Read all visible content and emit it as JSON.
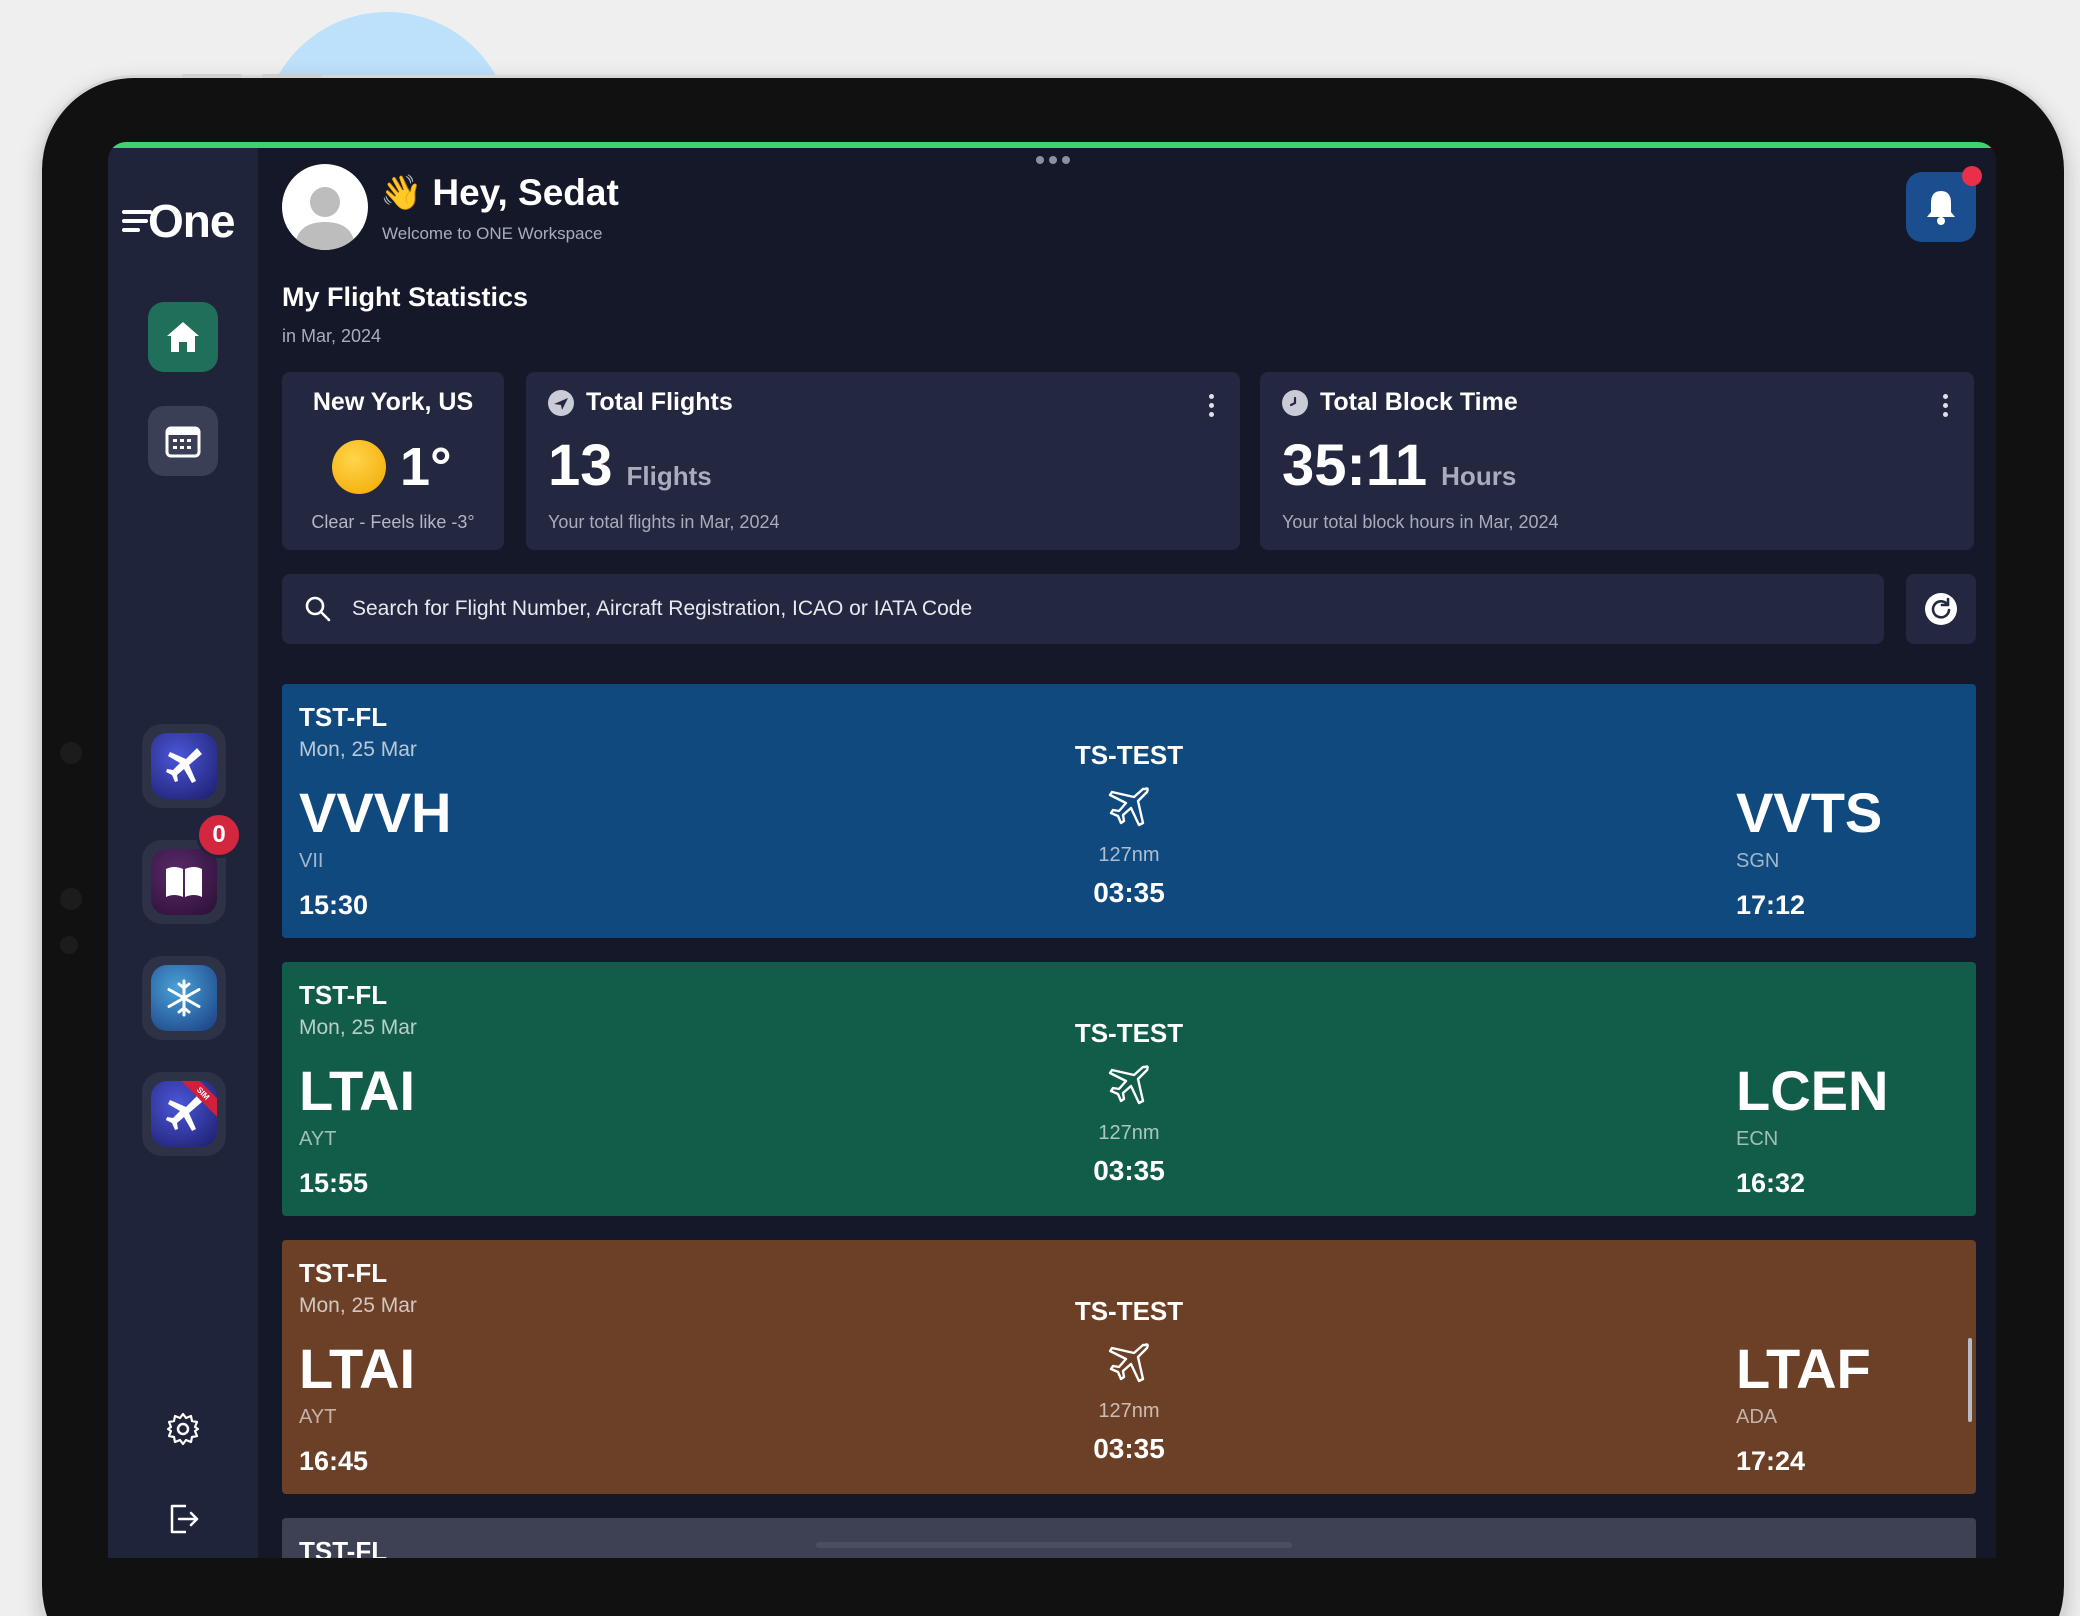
{
  "app": {
    "logo": "One"
  },
  "header": {
    "greeting_emoji": "👋",
    "greeting": "Hey, Sedat",
    "subtitle": "Welcome to ONE Workspace"
  },
  "stats": {
    "title": "My Flight Statistics",
    "period": "in Mar, 2024"
  },
  "weather": {
    "city": "New York, US",
    "temp": "1°",
    "desc": "Clear - Feels like -3°"
  },
  "total_flights": {
    "label": "Total Flights",
    "value": "13",
    "unit": "Flights",
    "footer": "Your total flights in Mar, 2024"
  },
  "block_time": {
    "label": "Total Block Time",
    "value": "35:11",
    "unit": "Hours",
    "footer": "Your total block hours in Mar, 2024"
  },
  "search": {
    "placeholder": "Search for Flight Number, Aircraft Registration, ICAO or IATA Code"
  },
  "sidebar": {
    "logbook_badge": "0",
    "sim_ribbon": "SIM"
  },
  "flights": [
    {
      "code": "TST-FL",
      "date": "Mon, 25 Mar",
      "from": "VVVH",
      "from_iata": "VII",
      "dep": "15:30",
      "reg": "TS-TEST",
      "dist": "127nm",
      "dur": "03:35",
      "to": "VVTS",
      "to_iata": "SGN",
      "arr": "17:12"
    },
    {
      "code": "TST-FL",
      "date": "Mon, 25 Mar",
      "from": "LTAI",
      "from_iata": "AYT",
      "dep": "15:55",
      "reg": "TS-TEST",
      "dist": "127nm",
      "dur": "03:35",
      "to": "LCEN",
      "to_iata": "ECN",
      "arr": "16:32"
    },
    {
      "code": "TST-FL",
      "date": "Mon, 25 Mar",
      "from": "LTAI",
      "from_iata": "AYT",
      "dep": "16:45",
      "reg": "TS-TEST",
      "dist": "127nm",
      "dur": "03:35",
      "to": "LTAF",
      "to_iata": "ADA",
      "arr": "17:24"
    },
    {
      "code": "TST-FL"
    }
  ],
  "colors": {
    "accent_green": "#3fd46a",
    "card_blue": "#10497e",
    "card_green": "#125c4a",
    "card_brown": "#6c4027",
    "badge_red": "#d4263f"
  }
}
